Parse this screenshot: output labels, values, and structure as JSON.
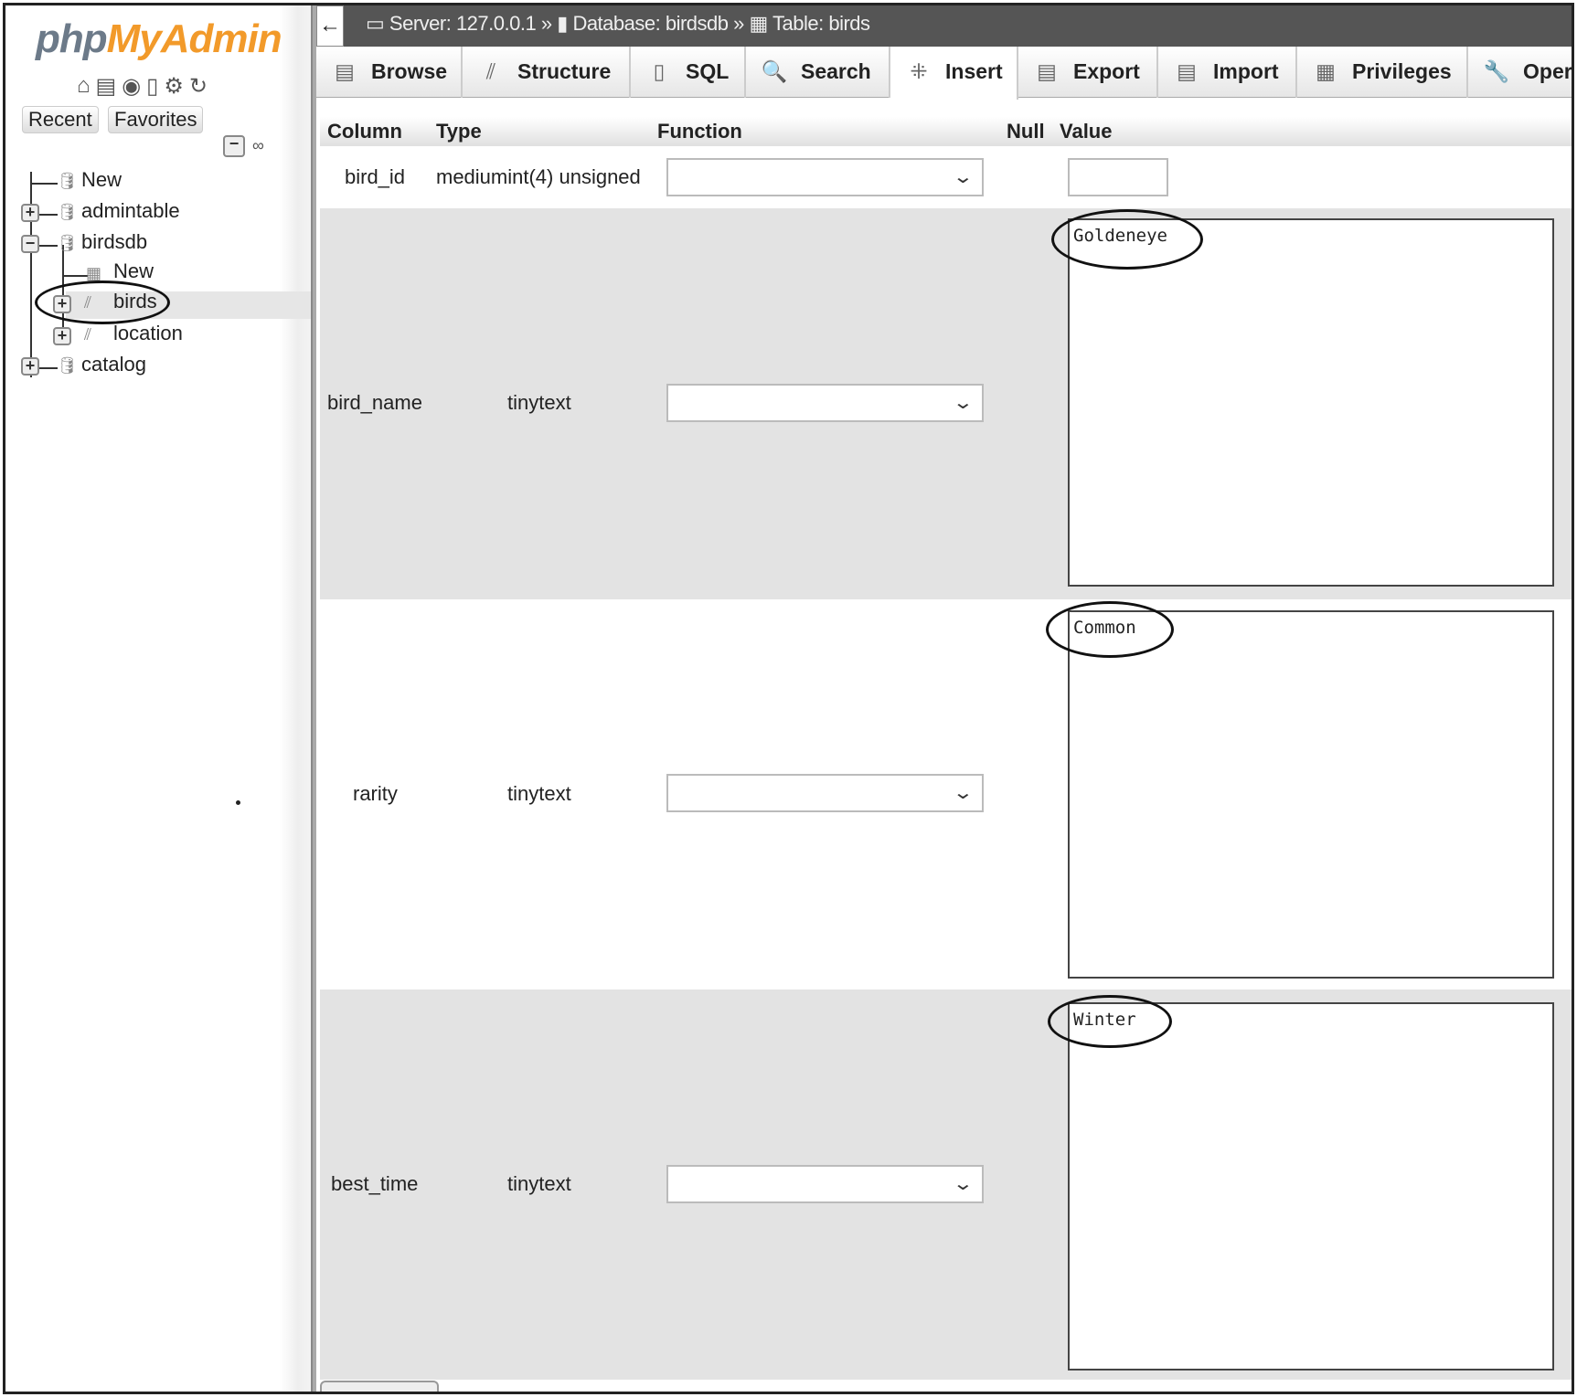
{
  "sidebar": {
    "logo": {
      "php": "php",
      "myadmin": "MyAdmin"
    },
    "buttons": {
      "recent": "Recent",
      "favorites": "Favorites"
    },
    "tree": [
      {
        "label": "New"
      },
      {
        "label": "admintable"
      },
      {
        "label": "birdsdb"
      },
      {
        "label": "New"
      },
      {
        "label": "birds"
      },
      {
        "label": "location"
      },
      {
        "label": "catalog"
      }
    ]
  },
  "breadcrumb": {
    "server": "Server: 127.0.0.1",
    "database": "Database: birdsdb",
    "table": "Table: birds",
    "sep": "»"
  },
  "tabs": [
    {
      "label": "Browse"
    },
    {
      "label": "Structure"
    },
    {
      "label": "SQL"
    },
    {
      "label": "Search"
    },
    {
      "label": "Insert"
    },
    {
      "label": "Export"
    },
    {
      "label": "Import"
    },
    {
      "label": "Privileges"
    },
    {
      "label": "Operations"
    }
  ],
  "table": {
    "headers": {
      "column": "Column",
      "type": "Type",
      "function": "Function",
      "null": "Null",
      "value": "Value"
    },
    "rows": [
      {
        "column": "bird_id",
        "type": "mediumint(4) unsigned",
        "function": "",
        "value": ""
      },
      {
        "column": "bird_name",
        "type": "tinytext",
        "function": "",
        "value": "Goldeneye"
      },
      {
        "column": "rarity",
        "type": "tinytext",
        "function": "",
        "value": "Common"
      },
      {
        "column": "best_time",
        "type": "tinytext",
        "function": "",
        "value": "Winter"
      }
    ]
  },
  "colors": {
    "accent": "#f29a2a",
    "topbar": "#555555",
    "row_alt": "#e3e3e3"
  }
}
